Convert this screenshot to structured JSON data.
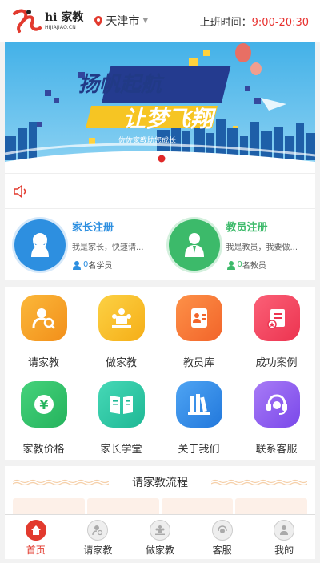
{
  "header": {
    "logo_name": "hi 家教",
    "logo_domain": "HIJIAJIAO.CN",
    "city": "天津市",
    "hours_label": "上班时间：",
    "hours_value": "9:00-20:30"
  },
  "banner": {
    "headline_left": "扬帆起航",
    "headline_right": "让梦飞翔",
    "ribbon_text": "佐佐家教助您成长",
    "slide_count": 1,
    "active_slide": 1
  },
  "register": {
    "parent": {
      "title": "家长注册",
      "desc": "我是家长，快速请...",
      "count_num": "0",
      "count_unit": "名学员",
      "icon": "parent-user-icon"
    },
    "teacher": {
      "title": "教员注册",
      "desc": "我是教员，我要做...",
      "count_num": "0",
      "count_unit": "名教员",
      "icon": "teacher-user-icon"
    }
  },
  "grid": {
    "items": [
      {
        "label": "请家教",
        "icon": "person-search-icon",
        "color": "#f7a127"
      },
      {
        "label": "做家教",
        "icon": "teaching-icon",
        "color": "#f9c12b"
      },
      {
        "label": "教员库",
        "icon": "id-card-icon",
        "color": "#fa7a39"
      },
      {
        "label": "成功案例",
        "icon": "award-icon",
        "color": "#f34a62"
      },
      {
        "label": "家教价格",
        "icon": "yuan-icon",
        "color": "#34c36d"
      },
      {
        "label": "家长学堂",
        "icon": "book-icon",
        "color": "#34c6a7"
      },
      {
        "label": "关于我们",
        "icon": "books-shelf-icon",
        "color": "#3a8ee8"
      },
      {
        "label": "联系客服",
        "icon": "headset-icon",
        "color": "#8d5ef0"
      }
    ]
  },
  "process": {
    "title": "请家教流程"
  },
  "bottom_nav": {
    "items": [
      {
        "label": "首页",
        "icon": "home-icon",
        "active": true
      },
      {
        "label": "请家教",
        "icon": "person-search-icon",
        "active": false
      },
      {
        "label": "做家教",
        "icon": "teaching-icon",
        "active": false
      },
      {
        "label": "客服",
        "icon": "support-icon",
        "active": false
      },
      {
        "label": "我的",
        "icon": "profile-icon",
        "active": false
      }
    ]
  },
  "colors": {
    "accent_red": "#e23a2e",
    "parent_blue": "#2d8fe0",
    "teacher_green": "#3cba6a"
  }
}
